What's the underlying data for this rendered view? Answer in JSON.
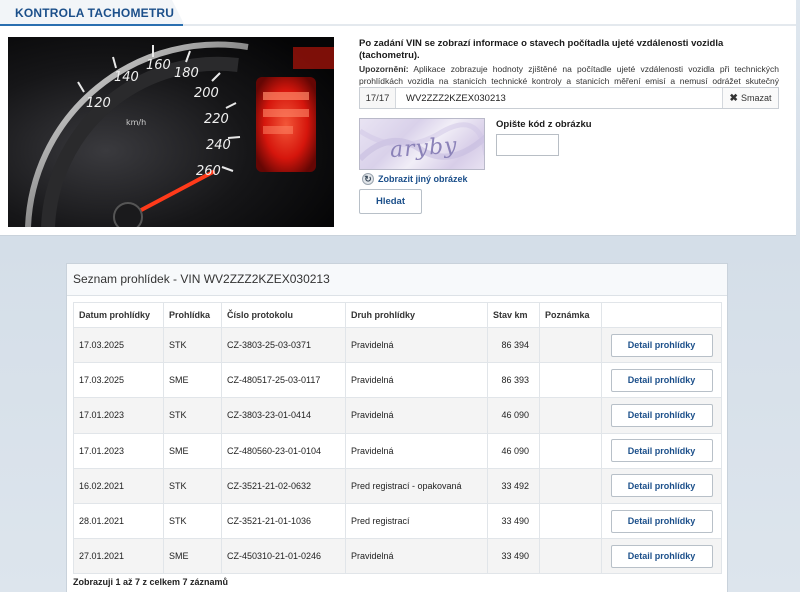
{
  "header": {
    "title": "KONTROLA TACHOMETRU"
  },
  "form": {
    "lead": "Po zadání VIN se zobrazí informace o stavech počítadla ujeté vzdálenosti vozidla (tachometru).",
    "note_label": "Upozornění:",
    "note_text": " Aplikace zobrazuje hodnoty zjištěné na počítadle ujeté vzdálenosti vozidla při technických prohlídkách vozidla na stanicích technické kontroly a stanicích měření emisí a nemusí odrážet skutečný (aktuální) celkový stav ujetých kilometrů vozidla.",
    "vin_counter": "17/17",
    "vin_value": "WV2ZZZ2KZEX030213",
    "clear_label": "Smazat",
    "captcha_text": "aryby",
    "captcha_label": "Opište kód z obrázku",
    "refresh_label": "Zobrazit jiný obrázek",
    "search_label": "Hledat"
  },
  "photo": {
    "gauge_labels": [
      "120",
      "140",
      "160",
      "180",
      "200",
      "220",
      "240",
      "260"
    ],
    "unit": "km/h"
  },
  "results": {
    "title": "Seznam prohlídek - VIN WV2ZZZ2KZEX030213",
    "columns": [
      "Datum prohlídky",
      "Prohlídka",
      "Číslo protokolu",
      "Druh prohlídky",
      "Stav km",
      "Poznámka",
      ""
    ],
    "rows": [
      {
        "date": "17.03.2025",
        "type": "STK",
        "protocol": "CZ-3803-25-03-0371",
        "kind": "Pravidelná",
        "km": "86 394",
        "note": "",
        "action": "Detail prohlídky"
      },
      {
        "date": "17.03.2025",
        "type": "SME",
        "protocol": "CZ-480517-25-03-0117",
        "kind": "Pravidelná",
        "km": "86 393",
        "note": "",
        "action": "Detail prohlídky"
      },
      {
        "date": "17.01.2023",
        "type": "STK",
        "protocol": "CZ-3803-23-01-0414",
        "kind": "Pravidelná",
        "km": "46 090",
        "note": "",
        "action": "Detail prohlídky"
      },
      {
        "date": "17.01.2023",
        "type": "SME",
        "protocol": "CZ-480560-23-01-0104",
        "kind": "Pravidelná",
        "km": "46 090",
        "note": "",
        "action": "Detail prohlídky"
      },
      {
        "date": "16.02.2021",
        "type": "STK",
        "protocol": "CZ-3521-21-02-0632",
        "kind": "Pred registrací - opakovaná",
        "km": "33 492",
        "note": "",
        "action": "Detail prohlídky"
      },
      {
        "date": "28.01.2021",
        "type": "STK",
        "protocol": "CZ-3521-21-01-1036",
        "kind": "Pred registrací",
        "km": "33 490",
        "note": "",
        "action": "Detail prohlídky"
      },
      {
        "date": "27.01.2021",
        "type": "SME",
        "protocol": "CZ-450310-21-01-0246",
        "kind": "Pravidelná",
        "km": "33 490",
        "note": "",
        "action": "Detail prohlídky"
      }
    ],
    "summary": "Zobrazuji 1 až 7 z celkem 7 záznamů"
  },
  "colors": {
    "brand_blue": "#1b4f8a",
    "accent_line": "#2a6fb0",
    "gauge_red": "#ff2a1a"
  }
}
